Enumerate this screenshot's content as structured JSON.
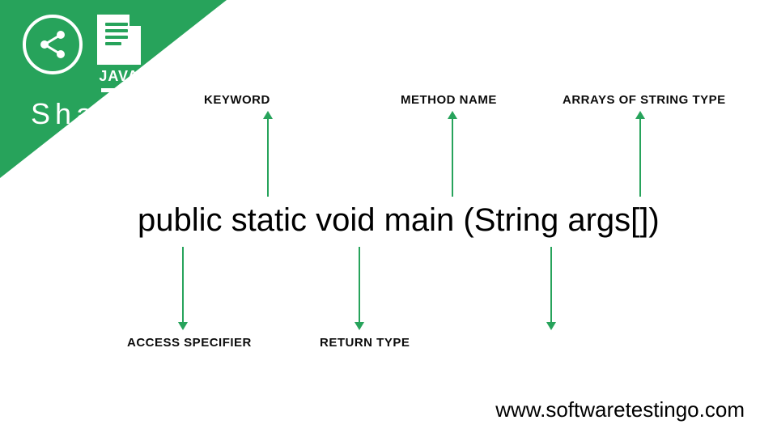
{
  "branding": {
    "share_label": "Share",
    "java_label": "JAVA"
  },
  "code": {
    "full": "public static void main (String args[])"
  },
  "annotations": {
    "keyword": "KEYWORD",
    "method_name": "METHOD NAME",
    "arrays_of_string": "ARRAYS OF STRING TYPE",
    "access_specifier": "ACCESS SPECIFIER",
    "return_type": "RETURN TYPE"
  },
  "footer": {
    "url": "www.softwaretestingo.com"
  },
  "colors": {
    "accent": "#27a35b"
  }
}
